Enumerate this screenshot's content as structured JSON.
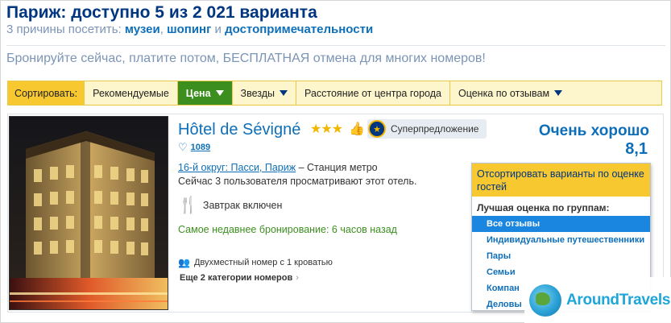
{
  "header": {
    "title": "Париж: доступно 5 из 2 021 варианта",
    "subtitle_prefix": "3 причины посетить:",
    "reason_1": "музеи",
    "sep_1": ",",
    "reason_2": "шопинг",
    "sep_2": "и",
    "reason_3": "достопримечательности",
    "promo": "Бронируйте сейчас, платите потом, БЕСПЛАТНАЯ отмена для многих номеров!"
  },
  "sortbar": {
    "label": "Сортировать:",
    "recommended": "Рекомендуемые",
    "price": "Цена",
    "stars": "Звезды",
    "distance": "Расстояние от центра города",
    "reviews": "Оценка по отзывам"
  },
  "hotel": {
    "name": "Hôtel de Sévigné",
    "stars": "★★★",
    "badge": "Суперпредложение",
    "likes": "1089",
    "location_link": "16-й округ: Пасси, Париж",
    "location_rest": "– Станция метро",
    "viewing": "Сейчас 3 пользователя просматривают этот отель.",
    "breakfast": "Завтрак включен",
    "recent_booking": "Самое недавнее бронирование: 6 часов назад",
    "room": "Двухместный номер с 1 кроватью",
    "more_rooms": "Еще 2 категории номеров",
    "rating_text": "Очень хорошо",
    "rating_score": "8,1"
  },
  "dropdown": {
    "header": "Отсортировать варианты по оценке гостей",
    "subheader": "Лучшая оценка по группам:",
    "items": [
      "Все отзывы",
      "Индивидуальные путешественники",
      "Пары",
      "Семьи",
      "Компан",
      "Деловы"
    ]
  },
  "watermark": {
    "text": "AroundTravels"
  },
  "colors": {
    "brand_blue": "#003580",
    "link_blue": "#0e6fb8",
    "active_green": "#3c8f1f",
    "sort_yellow": "#f7c830",
    "selected_item": "#1a86e0"
  }
}
